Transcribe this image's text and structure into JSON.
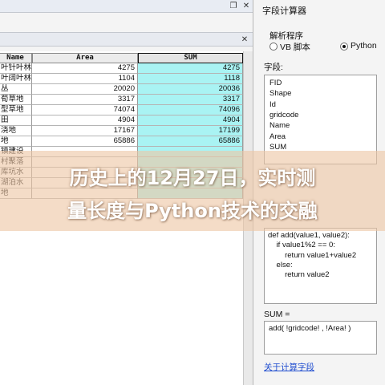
{
  "table": {
    "columns": [
      {
        "label": "Name"
      },
      {
        "label": "Area"
      },
      {
        "label": "SUM"
      }
    ],
    "rows": [
      {
        "name": "叶针叶林",
        "area": "4275",
        "sum": "4275"
      },
      {
        "name": "叶阔叶林",
        "area": "1104",
        "sum": "1118"
      },
      {
        "name": "丛",
        "area": "20020",
        "sum": "20036"
      },
      {
        "name": "荀草地",
        "area": "3317",
        "sum": "3317"
      },
      {
        "name": "型草地",
        "area": "74074",
        "sum": "74096"
      },
      {
        "name": "田",
        "area": "4904",
        "sum": "4904"
      },
      {
        "name": "浇地",
        "area": "17167",
        "sum": "17199"
      },
      {
        "name": "地",
        "area": "65886",
        "sum": "65886"
      },
      {
        "name": "镇建设",
        "area": "",
        "sum": ""
      },
      {
        "name": "村聚落",
        "area": "",
        "sum": ""
      },
      {
        "name": "库坑水",
        "area": "",
        "sum": ""
      },
      {
        "name": "湖泊水",
        "area": "",
        "sum": ""
      },
      {
        "name": "地",
        "area": "",
        "sum": ""
      }
    ]
  },
  "calculator": {
    "title": "字段计算器",
    "parser_label": "解析程序",
    "parser_options": [
      "VB 脚本",
      "Python"
    ],
    "selected_parser": "Python",
    "fields_label": "字段:",
    "fields": [
      "FID",
      "Shape",
      "Id",
      "gridcode",
      "Name",
      "Area",
      "SUM"
    ],
    "code_lines": [
      "def add(value1, value2):",
      "    if value1%2 == 0:",
      "        return value1+value2",
      "    else:",
      "        return value2"
    ],
    "expression_label": "SUM =",
    "expression": "add( !gridcode! , !Area! )",
    "about_link": "关于计算字段"
  },
  "overlay": {
    "line1": "历史上的12月27日，实时测",
    "line2": "量长度与Python技术的交融"
  },
  "colors": {
    "sum_column": "#a9f3f3",
    "overlay": "#edc7a5",
    "link": "#1e4ccf"
  }
}
